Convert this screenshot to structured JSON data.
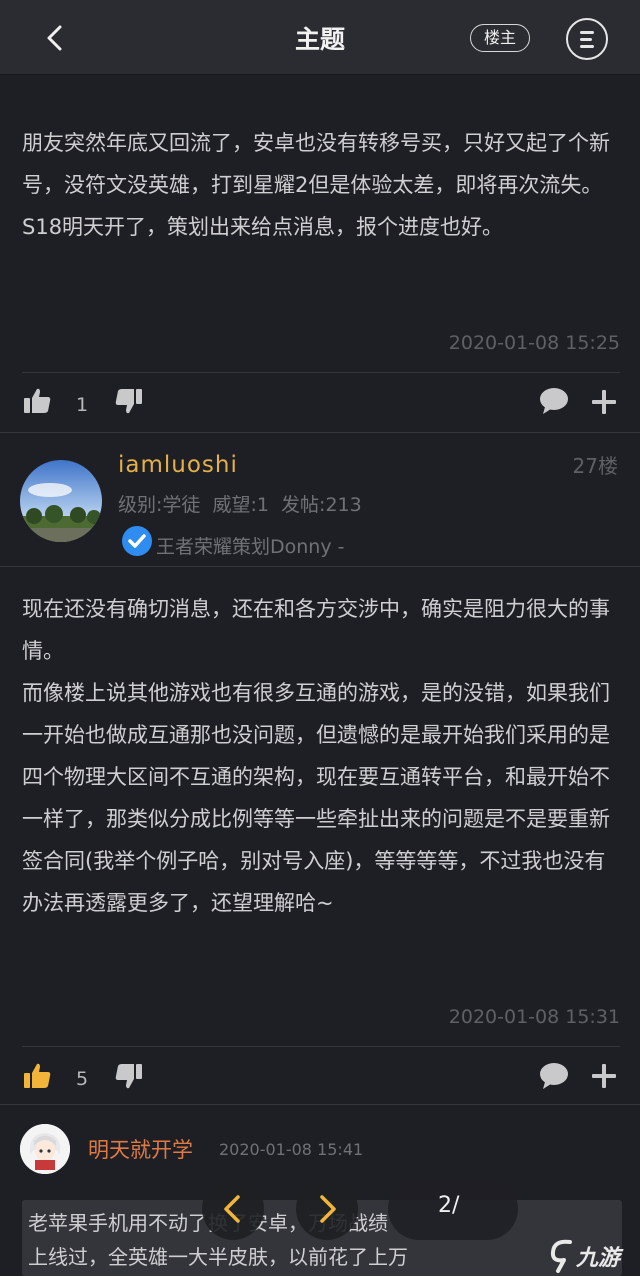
{
  "header": {
    "title": "主题",
    "op_label": "楼主"
  },
  "post1": {
    "text": "朋友突然年底又回流了，安卓也没有转移号买，只好又起了个新号，没符文没英雄，打到星耀2但是体验太差，即将再次流失。\nS18明天开了，策划出来给点消息，报个进度也好。",
    "time": "2020-01-08 15:25",
    "likes": "1"
  },
  "post2": {
    "username": "iamluoshi",
    "floor": "27楼",
    "stats": "级别:学徒  威望:1  发帖:213",
    "verified_title": "王者荣耀策划Donny -",
    "text": "现在还没有确切消息，还在和各方交涉中，确实是阻力很大的事情。\n而像楼上说其他游戏也有很多互通的游戏，是的没错，如果我们一开始也做成互通那也没问题，但遗憾的是最开始我们采用的是四个物理大区间不互通的架构，现在要互通转平台，和最开始不一样了，那类似分成比例等等一些牵扯出来的问题是不是要重新签合同(我举个例子哈，别对号入座)，等等等等，不过我也没有办法再透露更多了，还望理解哈~",
    "time": "2020-01-08 15:31",
    "likes": "5"
  },
  "reply": {
    "username": "明天就开学",
    "time": "2020-01-08 15:41",
    "text": "老苹果手机用不动了换了安卓，万场战绩\n上线过，全英雄一大半皮肤，以前花了上万"
  },
  "pager": {
    "current": "2/"
  },
  "watermark": {
    "text": "九游"
  },
  "colors": {
    "accent": "#e3b04a",
    "reply_name": "#e07a44",
    "verified": "#2f8cf0",
    "like_active": "#f2b53a"
  }
}
